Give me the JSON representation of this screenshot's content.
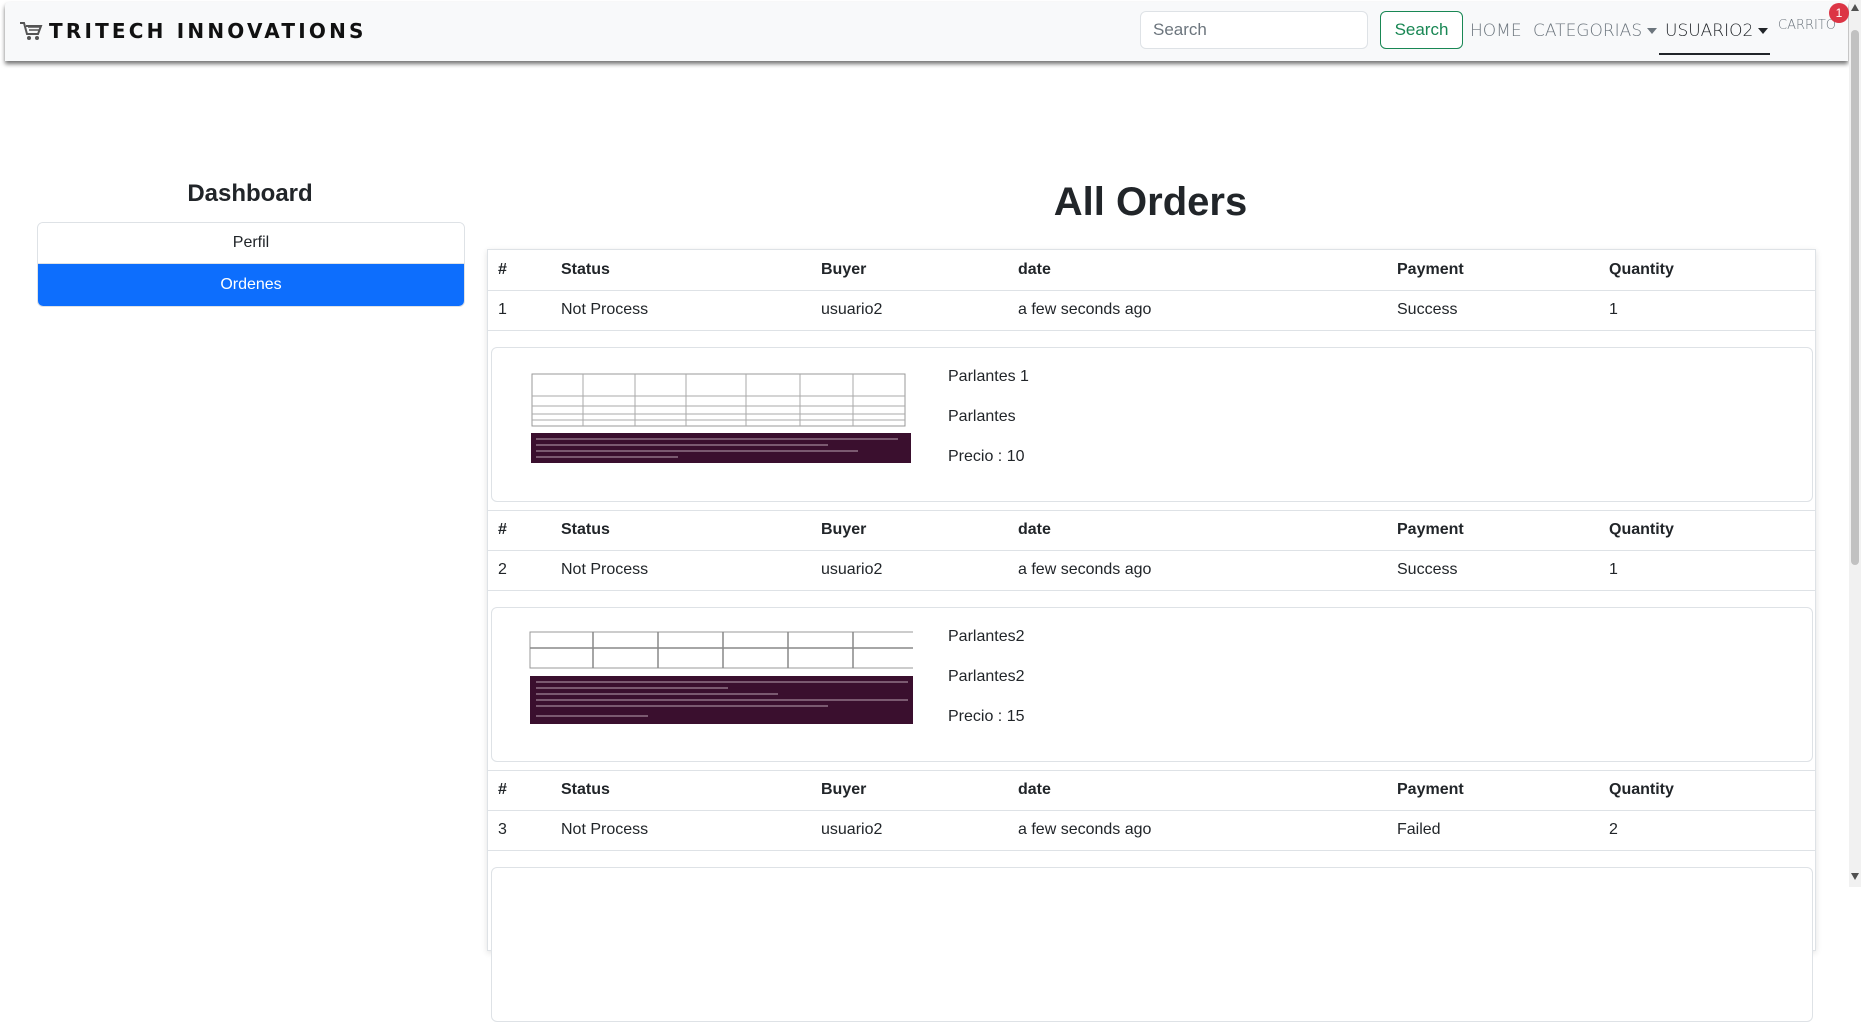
{
  "navbar": {
    "brand": "TRITECH INNOVATIONS",
    "brand_icon": "shopping-cart-icon",
    "search_placeholder": "Search",
    "search_button": "Search",
    "home": "HOME",
    "categories": "CATEGORIAS",
    "user": "USUARIO2",
    "cart": "CARRITO",
    "cart_count": "1"
  },
  "sidebar": {
    "title": "Dashboard",
    "items": [
      {
        "label": "Perfil",
        "active": false
      },
      {
        "label": "Ordenes",
        "active": true
      }
    ]
  },
  "main": {
    "title": "All Orders",
    "headers": [
      "#",
      "Status",
      "Buyer",
      "date",
      "Payment",
      "Quantity"
    ],
    "orders": [
      {
        "row": [
          "1",
          "Not Process",
          "usuario2",
          "a few seconds ago",
          "Success",
          "1"
        ],
        "product": {
          "name": "Parlantes 1",
          "description": "Parlantes",
          "price": "Precio : 10"
        }
      },
      {
        "row": [
          "2",
          "Not Process",
          "usuario2",
          "a few seconds ago",
          "Success",
          "1"
        ],
        "product": {
          "name": "Parlantes2",
          "description": "Parlantes2",
          "price": "Precio : 15"
        }
      },
      {
        "row": [
          "3",
          "Not Process",
          "usuario2",
          "a few seconds ago",
          "Failed",
          "2"
        ]
      }
    ]
  },
  "colors": {
    "primary": "#0d6efd",
    "success": "#198754",
    "danger": "#dc3545",
    "navbar_bg": "#f8f9fa"
  }
}
